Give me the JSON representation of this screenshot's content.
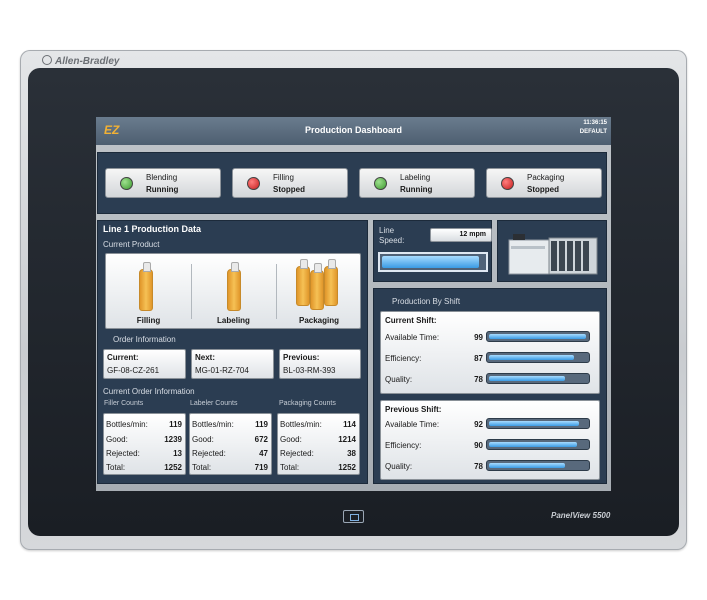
{
  "device": {
    "brand": "Allen-Bradley",
    "model": "PanelView 5500"
  },
  "header": {
    "title": "Production Dashboard",
    "time": "11:36:15",
    "user": "DEFAULT"
  },
  "stations": [
    {
      "name": "Blending",
      "state": "Running",
      "lamp": "green"
    },
    {
      "name": "Filling",
      "state": "Stopped",
      "lamp": "red"
    },
    {
      "name": "Labeling",
      "state": "Running",
      "lamp": "green"
    },
    {
      "name": "Packaging",
      "state": "Stopped",
      "lamp": "red"
    }
  ],
  "line1": {
    "title": "Line 1 Production Data",
    "current_product_label": "Current Product",
    "product_steps": [
      "Filling",
      "Labeling",
      "Packaging"
    ],
    "order_info_label": "Order Information",
    "orders": [
      {
        "key": "Current:",
        "value": "GF-08-CZ-261"
      },
      {
        "key": "Next:",
        "value": "MG-01-RZ-704"
      },
      {
        "key": "Previous:",
        "value": "BL-03-RM-393"
      }
    ],
    "current_order_label": "Current Order Information",
    "counts": [
      {
        "title": "Filler Counts",
        "rows": [
          [
            "Bottles/min:",
            "119"
          ],
          [
            "Good:",
            "1239"
          ],
          [
            "Rejected:",
            "13"
          ],
          [
            "Total:",
            "1252"
          ]
        ]
      },
      {
        "title": "Labeler Counts",
        "rows": [
          [
            "Bottles/min:",
            "119"
          ],
          [
            "Good:",
            "672"
          ],
          [
            "Rejected:",
            "47"
          ],
          [
            "Total:",
            "719"
          ]
        ]
      },
      {
        "title": "Packaging Counts",
        "rows": [
          [
            "Bottles/min:",
            "114"
          ],
          [
            "Good:",
            "1214"
          ],
          [
            "Rejected:",
            "38"
          ],
          [
            "Total:",
            "1252"
          ]
        ]
      }
    ]
  },
  "line_speed": {
    "label_1": "Line",
    "label_2": "Speed:",
    "value": "12 mpm",
    "fill_fraction": 0.95
  },
  "shift": {
    "title": "Production By Shift",
    "current": {
      "title": "Current Shift:",
      "rows": [
        {
          "label": "Available Time:",
          "value": "99",
          "fill": 0.99
        },
        {
          "label": "Efficiency:",
          "value": "87",
          "fill": 0.87
        },
        {
          "label": "Quality:",
          "value": "78",
          "fill": 0.78
        }
      ]
    },
    "previous": {
      "title": "Previous Shift:",
      "rows": [
        {
          "label": "Available Time:",
          "value": "92",
          "fill": 0.92
        },
        {
          "label": "Efficiency:",
          "value": "90",
          "fill": 0.9
        },
        {
          "label": "Quality:",
          "value": "78",
          "fill": 0.78
        }
      ]
    }
  }
}
